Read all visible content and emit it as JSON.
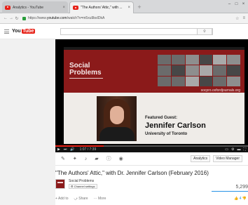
{
  "browser": {
    "tabs": [
      {
        "title": "Analytics - YouTube",
        "close": "×"
      },
      {
        "title": "\"The Authors' Attic,\" with ...",
        "close": "×"
      }
    ],
    "new_tab": "+",
    "url_prefix": "https://www.",
    "url_host": "youtube.com",
    "url_path": "/watch?v=m5xu9bsIDkA",
    "window_controls": [
      "–",
      "□",
      "×"
    ]
  },
  "masthead": {
    "logo_you": "You",
    "logo_tube": "Tube",
    "search_placeholder": "",
    "search_button": "⚲"
  },
  "video": {
    "slide_title_line1": "Social",
    "slide_title_line2": "Problems",
    "journal_url": "socpro.oxfordjournals.org",
    "featured_label": "Featured Guest:",
    "guest_name": "Jennifer Carlson",
    "guest_affiliation": "University of Toronto",
    "time": "1:07 / 7:39",
    "progress_fraction": 0.25,
    "controls": [
      "▶",
      "⏭",
      "🔊"
    ]
  },
  "toolbar": {
    "analytics": "Analytics",
    "video_manager": "Video Manager"
  },
  "info": {
    "title": "\"The Authors' Attic,\" with Dr. Jennifer Carlson (February 2016)",
    "channel_name": "Social Problems",
    "channel_settings": "⚙ Channel settings",
    "views": "5,299",
    "add_to": "+ Add to",
    "share": "⤻ Share",
    "more": "··· More",
    "likes": "👍 4  👎"
  }
}
